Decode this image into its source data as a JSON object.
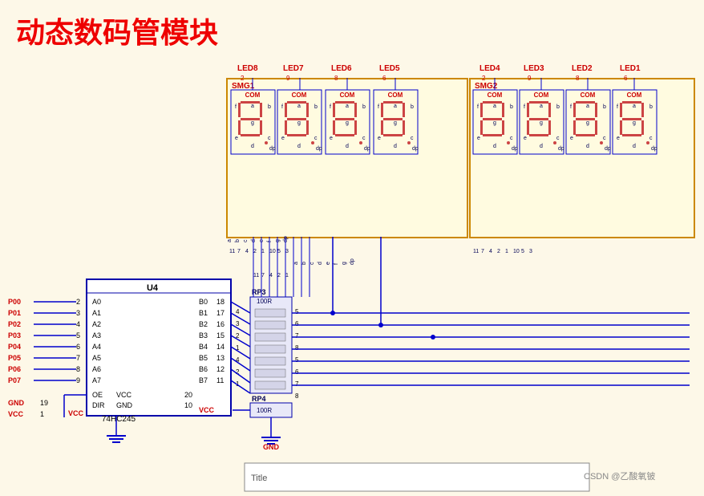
{
  "title": "动态数码管模块",
  "smg1": {
    "label": "SMG1",
    "leds": [
      "LED8",
      "LED7",
      "LED6",
      "LED5"
    ],
    "nums": [
      "2",
      "9",
      "8",
      "6"
    ]
  },
  "smg2": {
    "label": "SMG2",
    "leds": [
      "LED4",
      "LED3",
      "LED2",
      "LED1"
    ],
    "nums": [
      "2",
      "9",
      "8",
      "6"
    ]
  },
  "ic": {
    "name": "U4",
    "type": "74HC245",
    "pins_left": [
      {
        "name": "A0",
        "num": "2"
      },
      {
        "name": "A1",
        "num": "3"
      },
      {
        "name": "A2",
        "num": "4"
      },
      {
        "name": "A3",
        "num": "5"
      },
      {
        "name": "A4",
        "num": "6"
      },
      {
        "name": "A5",
        "num": "7"
      },
      {
        "name": "A6",
        "num": "8"
      },
      {
        "name": "A7",
        "num": "9"
      }
    ],
    "pins_right": [
      {
        "name": "B0",
        "num": "18"
      },
      {
        "name": "B1",
        "num": "17"
      },
      {
        "name": "B2",
        "num": "16"
      },
      {
        "name": "B3",
        "num": "15"
      },
      {
        "name": "B4",
        "num": "14"
      },
      {
        "name": "B5",
        "num": "13"
      },
      {
        "name": "B6",
        "num": "12"
      },
      {
        "name": "B7",
        "num": "11"
      }
    ],
    "bottom_left": [
      {
        "name": "OE",
        "num": ""
      },
      {
        "name": "DIR",
        "num": ""
      }
    ],
    "bottom_right": [
      {
        "name": "VCC",
        "num": "20"
      },
      {
        "name": "GND",
        "num": "10"
      }
    ]
  },
  "rp3": {
    "label": "RP3",
    "value": "100R"
  },
  "rp4": {
    "label": "RP4",
    "value": "100R"
  },
  "ports": [
    {
      "name": "P00",
      "num": "2"
    },
    {
      "name": "P01",
      "num": "3"
    },
    {
      "name": "P02",
      "num": "4"
    },
    {
      "name": "P03",
      "num": "5"
    },
    {
      "name": "P04",
      "num": "6"
    },
    {
      "name": "P05",
      "num": "7"
    },
    {
      "name": "P06",
      "num": "8"
    },
    {
      "name": "P07",
      "num": "9"
    }
  ],
  "gnd_port": {
    "name": "GND",
    "num": "19"
  },
  "vcc_port": {
    "name": "VCC",
    "num": "1"
  },
  "title_box": "Title",
  "watermark": "CSDN @乙酸氧铍",
  "rp3_right_pins": [
    "4",
    "3",
    "2",
    "1",
    "4",
    "2",
    "1"
  ],
  "rp3_left_pins": [
    "18",
    "17",
    "16",
    "15",
    "14",
    "13",
    "12",
    "11"
  ],
  "seg_pins_bottom": [
    "a",
    "b",
    "c",
    "d",
    "e",
    "f",
    "g",
    "dp"
  ],
  "com_label": "COM",
  "vcc_label": "VCC",
  "gnd_label": "GND"
}
